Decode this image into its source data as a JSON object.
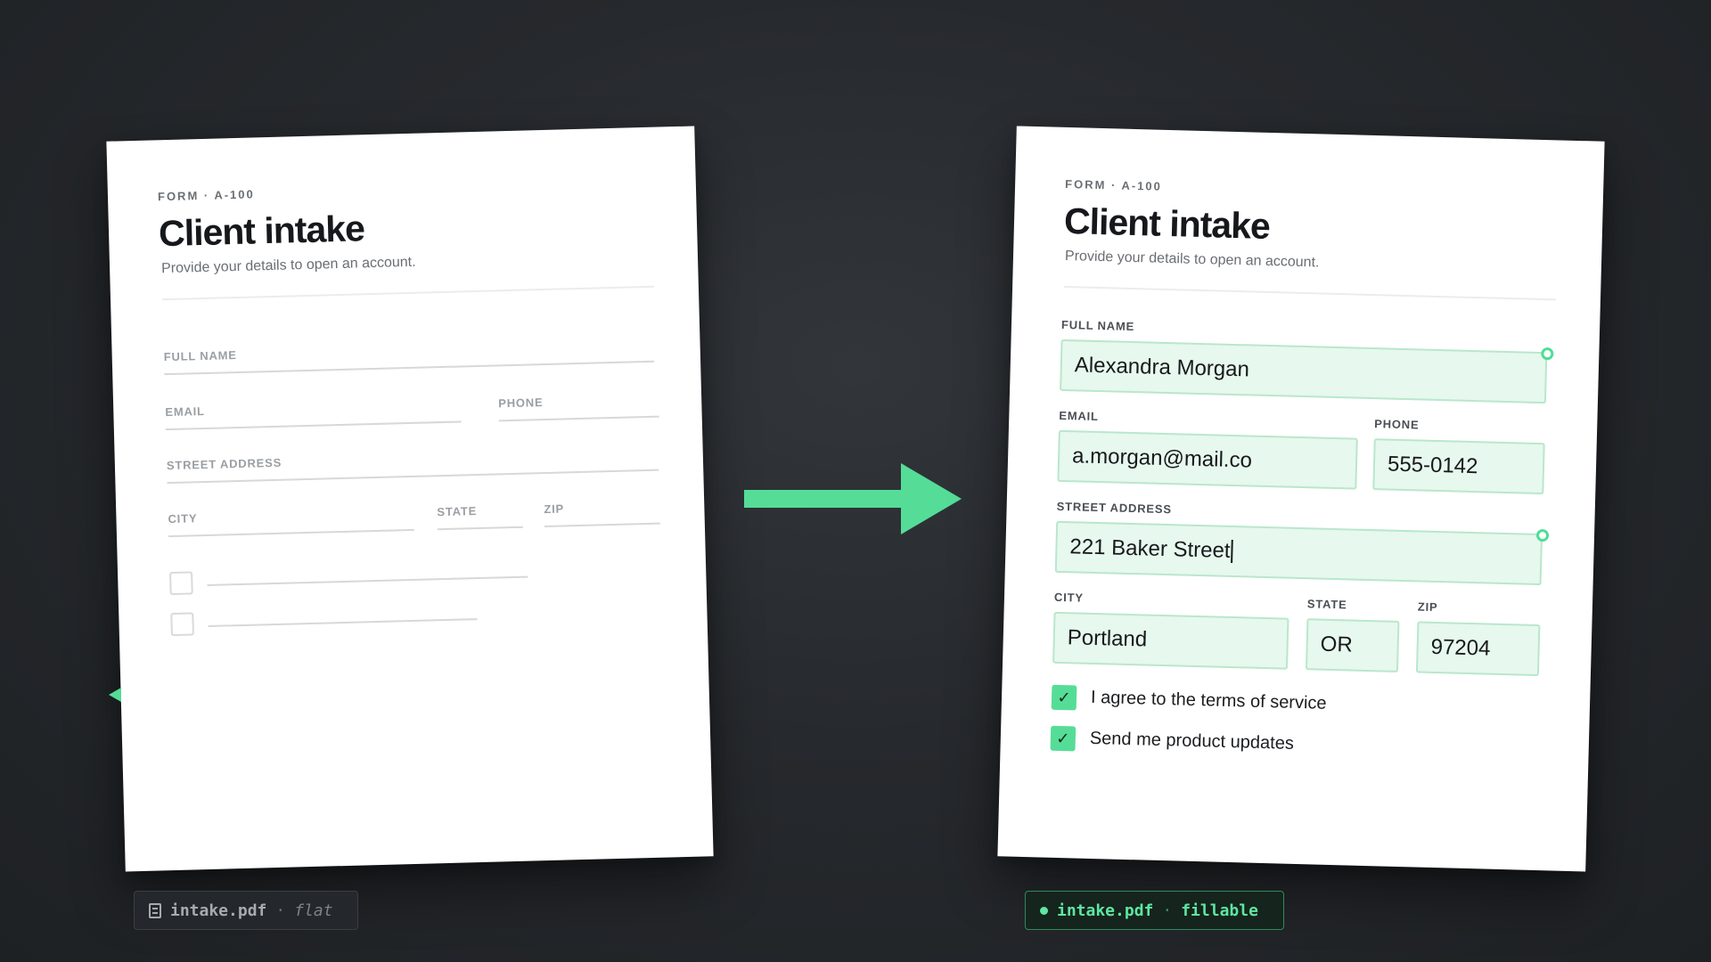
{
  "flat_form": {
    "form_code": "FORM · A-100",
    "title": "Client intake",
    "subtitle": "Provide your details to open an account.",
    "labels": {
      "full_name": "FULL NAME",
      "email": "EMAIL",
      "phone": "PHONE",
      "street": "STREET ADDRESS",
      "city": "CITY",
      "state": "STATE",
      "zip": "ZIP"
    }
  },
  "fillable_form": {
    "form_code": "FORM · A-100",
    "title": "Client intake",
    "subtitle": "Provide your details to open an account.",
    "labels": {
      "full_name": "FULL NAME",
      "email": "EMAIL",
      "phone": "PHONE",
      "street": "STREET ADDRESS",
      "city": "CITY",
      "state": "STATE",
      "zip": "ZIP"
    },
    "values": {
      "full_name": "Alexandra Morgan",
      "email": "a.morgan@mail.co",
      "phone": "555-0142",
      "street": "221 Baker Street",
      "city": "Portland",
      "state": "OR",
      "zip": "97204"
    },
    "checkboxes": [
      {
        "label": "I agree to the terms of service",
        "checked": true
      },
      {
        "label": "Send me product updates",
        "checked": true
      }
    ]
  },
  "tags": {
    "flat": {
      "file": "intake.pdf",
      "separator": "·",
      "kind": "flat",
      "icon": "document-icon"
    },
    "fillable": {
      "file": "intake.pdf",
      "separator": "·",
      "kind": "fillable",
      "icon": "status-dot-icon"
    }
  },
  "colors": {
    "accent": "#55dd97",
    "field_fill": "#e7f8ee",
    "field_border": "#b9e7cc",
    "background": "#26292d"
  }
}
